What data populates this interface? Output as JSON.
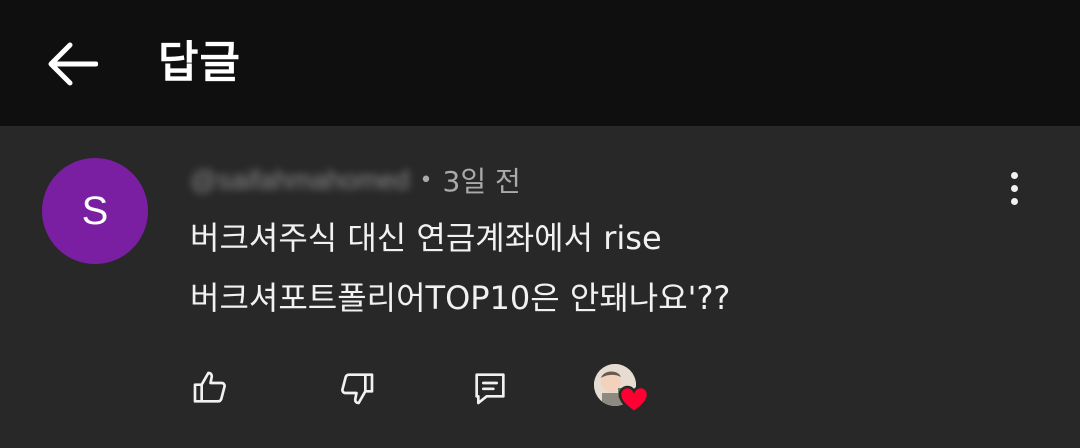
{
  "header": {
    "title": "답글",
    "back_icon": "arrow-left-icon"
  },
  "comment": {
    "avatar_letter": "S",
    "avatar_color": "#7b1fa2",
    "author_handle": "@saifahmahomed",
    "separator": "•",
    "timestamp": "3일 전",
    "text_line1": "버크셔주식 대신 연금계좌에서 rise",
    "text_line2": "버크셔포트폴리어TOP10은 안돼나요'??",
    "more_icon": "more-vertical-icon"
  },
  "actions": {
    "like_icon": "thumb-up-icon",
    "dislike_icon": "thumb-down-icon",
    "reply_icon": "comment-icon",
    "creator_heart_icon": "creator-heart-icon",
    "heart_color": "#ff0033"
  }
}
